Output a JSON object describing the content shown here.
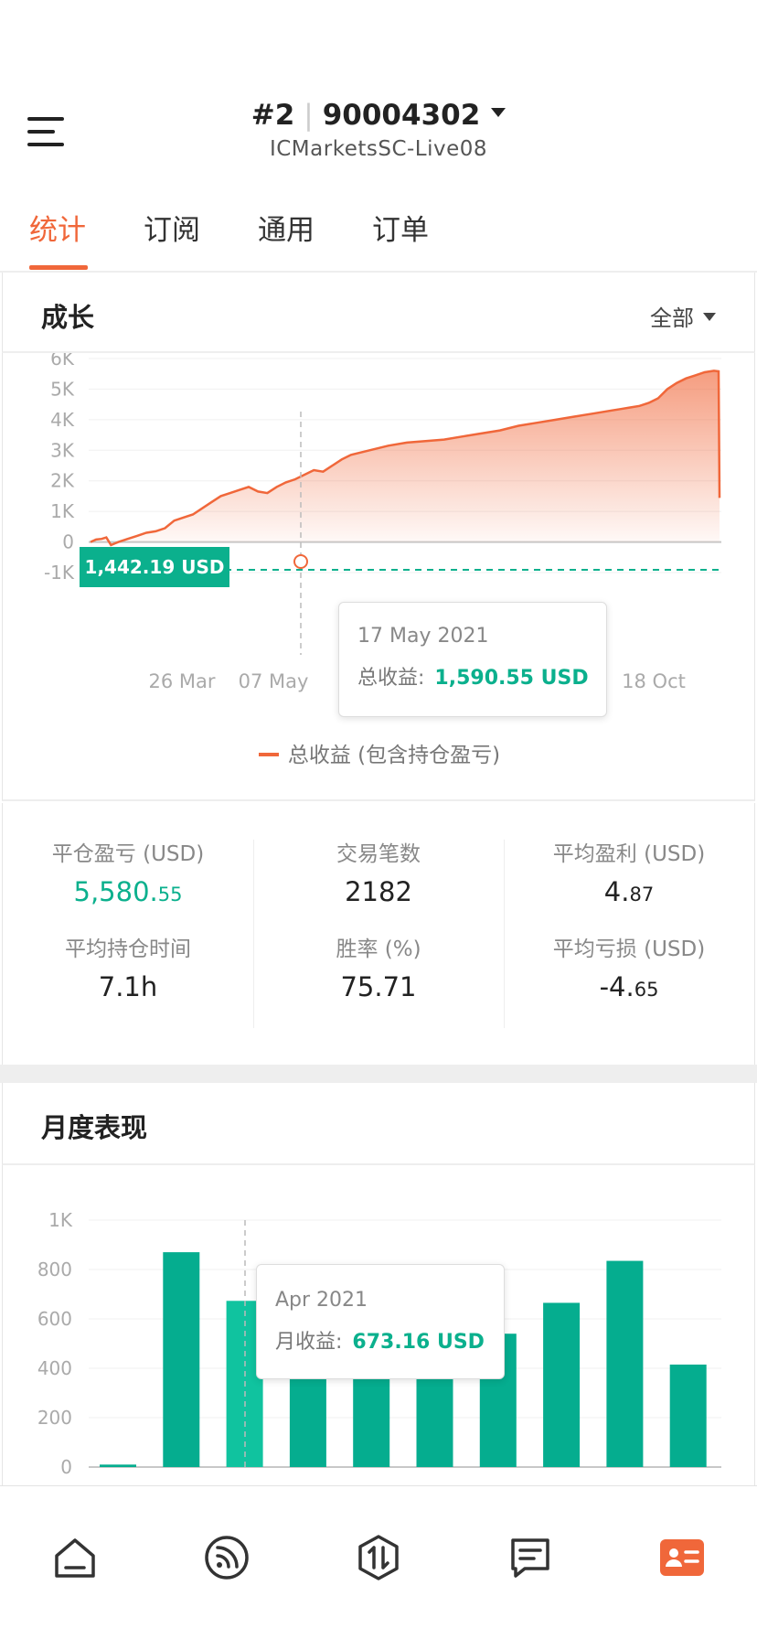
{
  "header": {
    "account_number": "#2",
    "account_id": "90004302",
    "server": "ICMarketsSC-Live08"
  },
  "tabs": [
    {
      "label": "统计",
      "active": true
    },
    {
      "label": "订阅",
      "active": false
    },
    {
      "label": "通用",
      "active": false
    },
    {
      "label": "订单",
      "active": false
    }
  ],
  "growth": {
    "title": "成长",
    "range": "全部",
    "current_marker": "1,442.19 USD",
    "tooltip": {
      "date": "17 May 2021",
      "label": "总收益:",
      "value": "1,590.55 USD"
    },
    "legend": "总收益 (包含持仓盈亏)"
  },
  "stats": [
    {
      "label": "平仓盈亏 (USD)",
      "int": "5,580.",
      "dec": "55",
      "green": true
    },
    {
      "label": "交易笔数",
      "int": "2182",
      "dec": "",
      "green": false
    },
    {
      "label": "平均盈利 (USD)",
      "int": "4.",
      "dec": "87",
      "green": false
    },
    {
      "label": "平均持仓时间",
      "int": "7.1h",
      "dec": "",
      "green": false
    },
    {
      "label": "胜率 (%)",
      "int": "75.71",
      "dec": "",
      "green": false
    },
    {
      "label": "平均亏损 (USD)",
      "int": "-4.",
      "dec": "65",
      "green": false
    }
  ],
  "monthly": {
    "title": "月度表现",
    "tooltip": {
      "date": "Apr 2021",
      "label": "月收益:",
      "value": "673.16 USD"
    }
  },
  "colors": {
    "accent": "#f0673a",
    "green": "#0bb08d",
    "bar": "#05ad8f"
  },
  "bottom_nav": [
    "home-icon",
    "feed-icon",
    "trade-icon",
    "message-icon",
    "profile-card-icon"
  ],
  "chart_data": [
    {
      "type": "area",
      "series": [
        {
          "name": "总收益 (包含持仓盈亏)"
        }
      ],
      "y_ticks": [
        "6K",
        "5K",
        "4K",
        "3K",
        "2K",
        "1K",
        "0",
        "-1K"
      ],
      "x_ticks": [
        "26 Mar",
        "07 May",
        "18 Oct"
      ],
      "ylim": [
        -1000,
        6000
      ],
      "points": [
        [
          0,
          0
        ],
        [
          6,
          80
        ],
        [
          12,
          100
        ],
        [
          17,
          150
        ],
        [
          22,
          -100
        ],
        [
          30,
          0
        ],
        [
          40,
          100
        ],
        [
          50,
          200
        ],
        [
          60,
          300
        ],
        [
          70,
          350
        ],
        [
          80,
          450
        ],
        [
          90,
          700
        ],
        [
          100,
          800
        ],
        [
          110,
          900
        ],
        [
          120,
          1100
        ],
        [
          130,
          1300
        ],
        [
          140,
          1500
        ],
        [
          150,
          1600
        ],
        [
          160,
          1700
        ],
        [
          170,
          1800
        ],
        [
          180,
          1650
        ],
        [
          190,
          1600
        ],
        [
          200,
          1800
        ],
        [
          210,
          1950
        ],
        [
          220,
          2050
        ],
        [
          230,
          2200
        ],
        [
          240,
          2350
        ],
        [
          250,
          2300
        ],
        [
          260,
          2500
        ],
        [
          270,
          2700
        ],
        [
          280,
          2850
        ],
        [
          300,
          3000
        ],
        [
          320,
          3150
        ],
        [
          340,
          3250
        ],
        [
          360,
          3300
        ],
        [
          380,
          3350
        ],
        [
          400,
          3450
        ],
        [
          420,
          3550
        ],
        [
          440,
          3650
        ],
        [
          460,
          3800
        ],
        [
          480,
          3900
        ],
        [
          500,
          4000
        ],
        [
          520,
          4100
        ],
        [
          540,
          4200
        ],
        [
          560,
          4300
        ],
        [
          570,
          4350
        ],
        [
          580,
          4400
        ],
        [
          590,
          4450
        ],
        [
          600,
          4550
        ],
        [
          610,
          4700
        ],
        [
          620,
          5000
        ],
        [
          630,
          5200
        ],
        [
          640,
          5350
        ],
        [
          650,
          5450
        ],
        [
          660,
          5550
        ],
        [
          670,
          5600
        ],
        [
          675,
          5580
        ],
        [
          676,
          1442
        ]
      ]
    },
    {
      "type": "bar",
      "y_ticks": [
        "1K",
        "800",
        "600",
        "400",
        "200",
        "0"
      ],
      "ylim": [
        0,
        1000
      ],
      "values": [
        10,
        870,
        673,
        400,
        390,
        380,
        540,
        665,
        835,
        415
      ]
    }
  ]
}
